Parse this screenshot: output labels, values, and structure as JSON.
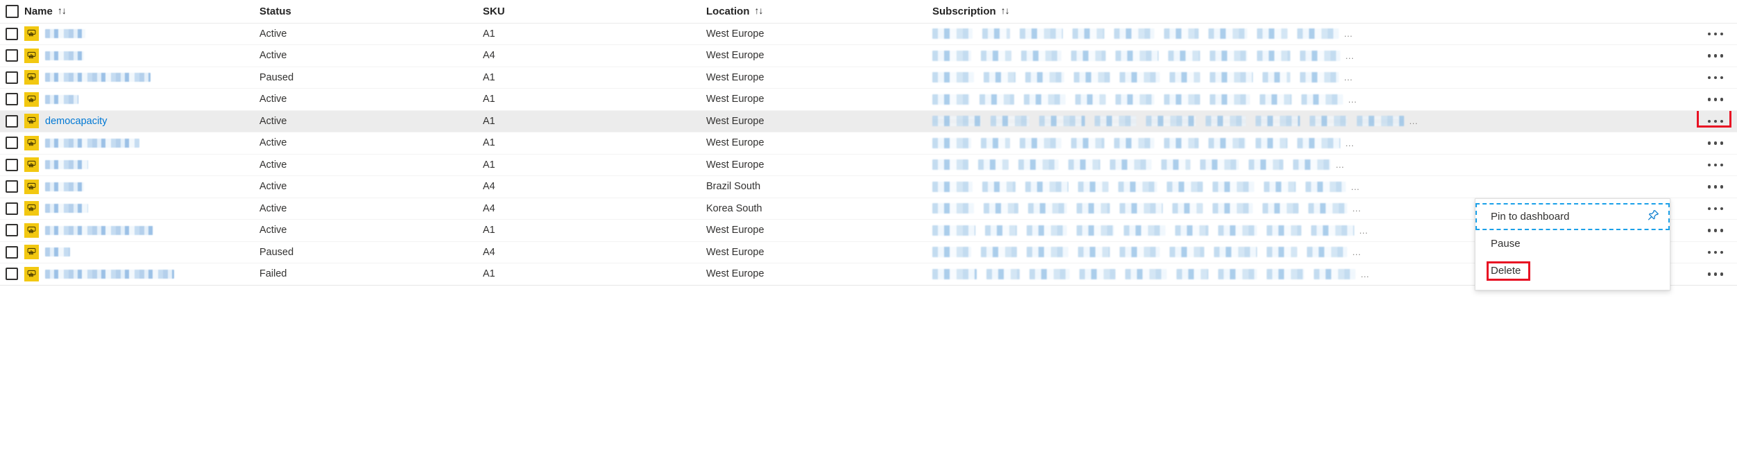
{
  "table": {
    "columns": [
      {
        "key": "check",
        "label": "",
        "sortable": false
      },
      {
        "key": "name",
        "label": "Name",
        "sortable": true
      },
      {
        "key": "status",
        "label": "Status",
        "sortable": false
      },
      {
        "key": "sku",
        "label": "SKU",
        "sortable": false
      },
      {
        "key": "loc",
        "label": "Location",
        "sortable": true
      },
      {
        "key": "sub",
        "label": "Subscription",
        "sortable": true
      }
    ],
    "sort_glyph": "↑↓",
    "select_all_checkbox": {
      "checked": false
    },
    "row_overflow_glyph": "…",
    "rows": [
      {
        "name": "",
        "name_redacted": true,
        "status": "Active",
        "sku": "A1",
        "location": "West Europe",
        "subscription_redacted": true,
        "selected": false,
        "hovered": false
      },
      {
        "name": "",
        "name_redacted": true,
        "status": "Active",
        "sku": "A4",
        "location": "West Europe",
        "subscription_redacted": true,
        "selected": false,
        "hovered": false
      },
      {
        "name": "",
        "name_redacted": true,
        "status": "Paused",
        "sku": "A1",
        "location": "West Europe",
        "subscription_redacted": true,
        "selected": false,
        "hovered": false
      },
      {
        "name": "",
        "name_redacted": true,
        "status": "Active",
        "sku": "A1",
        "location": "West Europe",
        "subscription_redacted": true,
        "selected": false,
        "hovered": false
      },
      {
        "name": "democapacity",
        "name_redacted": false,
        "status": "Active",
        "sku": "A1",
        "location": "West Europe",
        "subscription_redacted": true,
        "selected": false,
        "hovered": true
      },
      {
        "name": "",
        "name_redacted": true,
        "status": "Active",
        "sku": "A1",
        "location": "West Europe",
        "subscription_redacted": true,
        "selected": false,
        "hovered": false
      },
      {
        "name": "",
        "name_redacted": true,
        "status": "Active",
        "sku": "A1",
        "location": "West Europe",
        "subscription_redacted": true,
        "selected": false,
        "hovered": false
      },
      {
        "name": "",
        "name_redacted": true,
        "status": "Active",
        "sku": "A4",
        "location": "Brazil South",
        "subscription_redacted": true,
        "selected": false,
        "hovered": false
      },
      {
        "name": "",
        "name_redacted": true,
        "status": "Active",
        "sku": "A4",
        "location": "Korea South",
        "subscription_redacted": true,
        "selected": false,
        "hovered": false
      },
      {
        "name": "",
        "name_redacted": true,
        "status": "Active",
        "sku": "A1",
        "location": "West Europe",
        "subscription_redacted": true,
        "selected": false,
        "hovered": false
      },
      {
        "name": "",
        "name_redacted": true,
        "status": "Paused",
        "sku": "A4",
        "location": "West Europe",
        "subscription_redacted": true,
        "selected": false,
        "hovered": false
      },
      {
        "name": "",
        "name_redacted": true,
        "status": "Failed",
        "sku": "A1",
        "location": "West Europe",
        "subscription_redacted": true,
        "selected": false,
        "hovered": false
      }
    ]
  },
  "context_menu": {
    "open_for_row_index": 4,
    "items": [
      {
        "label": "Pin to dashboard",
        "icon": "pin-icon",
        "focused": true,
        "highlighted": false
      },
      {
        "label": "Pause",
        "icon": null,
        "focused": false,
        "highlighted": false
      },
      {
        "label": "Delete",
        "icon": null,
        "focused": false,
        "highlighted": true
      }
    ]
  },
  "annotations": {
    "highlight_color": "#e81123",
    "focus_outline_color": "#1aa0e8",
    "targets": [
      "row-more-button",
      "menu-item-delete"
    ]
  },
  "theme": {
    "link_color": "#0078d4",
    "text_color": "#323130",
    "header_text_color": "#242424",
    "row_hover_bg": "#ececec",
    "powerbi_yellow": "#f2c811",
    "border_color": "#f3f3f3"
  }
}
